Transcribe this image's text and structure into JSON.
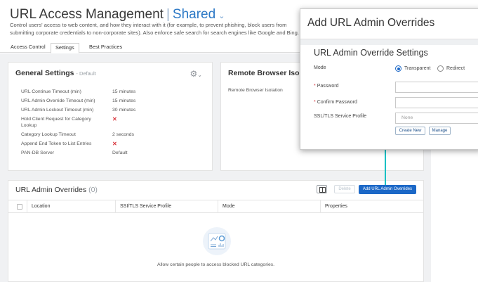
{
  "page": {
    "title": "URL Access Management",
    "separator": "|",
    "scope": "Shared",
    "description": "Control users' access to web content, and how they interact with it (for example, to prevent phishing, block users from submitting corporate credentials to non-corporate sites). Also enforce safe search for search engines like Google and Bing."
  },
  "tabs": [
    {
      "label": "Access Control",
      "active": false
    },
    {
      "label": "Settings",
      "active": true
    },
    {
      "label": "Best Practices",
      "active": false
    }
  ],
  "general_settings": {
    "title": "General Settings",
    "subtitle": "Default",
    "rows": [
      {
        "key": "URL Continue Timeout (min)",
        "value": "15 minutes"
      },
      {
        "key": "URL Admin Override Timeout (min)",
        "value": "15 minutes"
      },
      {
        "key": "URL Admin Lockout Timeout (min)",
        "value": "30 minutes"
      },
      {
        "key": "Hold Client Request for Category Lookup",
        "value": "✕"
      },
      {
        "key": "Category Lookup Timeout",
        "value": "2 seconds"
      },
      {
        "key": "Append End Token to List Entries",
        "value": "✕"
      },
      {
        "key": "PAN-DB Server",
        "value": "Default"
      }
    ]
  },
  "remote_browser": {
    "title": "Remote Browser Isolation",
    "label": "Remote Browser Isolation"
  },
  "overrides": {
    "title": "URL Admin Overrides",
    "count": "(0)",
    "delete_label": "Delete",
    "add_label": "Add URL Admin Overrides",
    "columns": [
      "Location",
      "SSI/TLS Service Profile",
      "Mode",
      "Properties"
    ],
    "empty_text": "Allow certain people to access blocked URL categories."
  },
  "modal": {
    "title": "Add URL Admin Overrides",
    "section_title": "URL Admin Override Settings",
    "mode_label": "Mode",
    "mode_options": [
      "Transparent",
      "Redirect"
    ],
    "mode_selected": "Transparent",
    "password_label": "Password",
    "confirm_password_label": "Confirm Password",
    "ssl_label": "SSL/TLS Service Profile",
    "ssl_placeholder": "None",
    "create_new_label": "Create New",
    "manage_label": "Manage"
  },
  "colors": {
    "accent": "#1c68c7",
    "connector": "#19c0c4",
    "danger": "#d9363e"
  }
}
